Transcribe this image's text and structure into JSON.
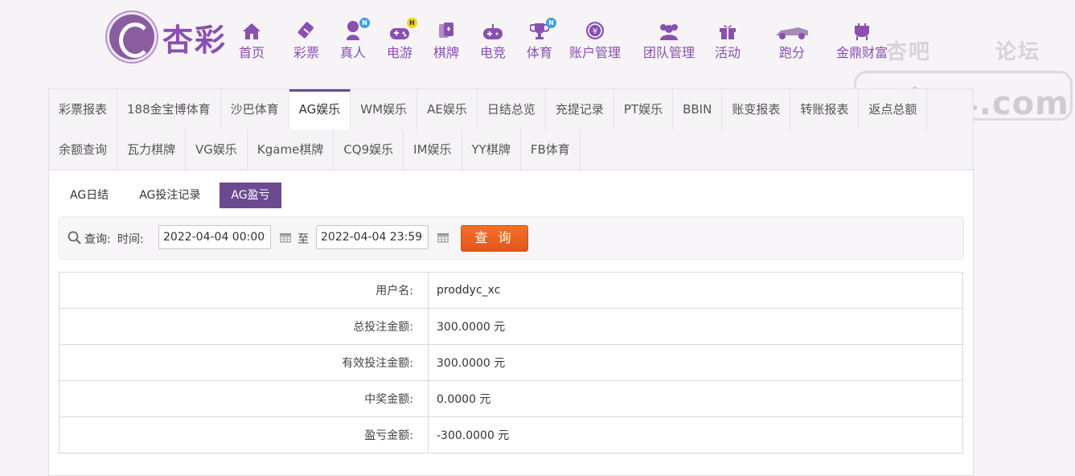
{
  "brand": {
    "name": "杏彩"
  },
  "nav": [
    {
      "label": "首页",
      "icon": "home-icon"
    },
    {
      "label": "彩票",
      "icon": "ticket-icon"
    },
    {
      "label": "真人",
      "icon": "live-dealer-icon",
      "badge": "N"
    },
    {
      "label": "电游",
      "icon": "gamepad-icon",
      "badge": "H"
    },
    {
      "label": "棋牌",
      "icon": "cards-icon"
    },
    {
      "label": "电竞",
      "icon": "esports-controller-icon"
    },
    {
      "label": "体育",
      "icon": "trophy-icon",
      "badge": "N"
    },
    {
      "label": "账户管理",
      "icon": "yen-coin-icon"
    },
    {
      "label": "团队管理",
      "icon": "team-icon"
    },
    {
      "label": "活动",
      "icon": "gift-icon"
    },
    {
      "label": "跑分",
      "icon": "race-car-icon"
    },
    {
      "label": "金鼎财富",
      "icon": "cauldron-icon"
    }
  ],
  "watermark": {
    "top_left": "杏吧",
    "top_right": "论坛",
    "url": "同家74.com"
  },
  "tabs_row1": [
    "彩票报表",
    "188金宝博体育",
    "沙巴体育",
    "AG娱乐",
    "WM娱乐",
    "AE娱乐",
    "日结总览",
    "充提记录",
    "PT娱乐",
    "BBIN",
    "账变报表",
    "转账报表",
    "返点总额"
  ],
  "tabs_row2": [
    "余额查询",
    "瓦力棋牌",
    "VG娱乐",
    "Kgame棋牌",
    "CQ9娱乐",
    "IM娱乐",
    "YY棋牌",
    "FB体育"
  ],
  "active_tab": "AG娱乐",
  "subtabs": [
    "AG日结",
    "AG投注记录",
    "AG盈亏"
  ],
  "active_subtab": "AG盈亏",
  "query": {
    "label": "查询:",
    "time_label": "时间:",
    "start": "2022-04-04 00:00:00",
    "to": "至",
    "end": "2022-04-04 23:59:59",
    "button": "查 询"
  },
  "result": [
    {
      "label": "用户名:",
      "value": "proddyc_xc"
    },
    {
      "label": "总投注金额:",
      "value": "300.0000 元"
    },
    {
      "label": "有效投注金额:",
      "value": "300.0000 元"
    },
    {
      "label": "中奖金额:",
      "value": "0.0000 元"
    },
    {
      "label": "盈亏金额:",
      "value": "-300.0000 元"
    }
  ],
  "colors": {
    "accent": "#6b4a91",
    "brand": "#8a4fb0",
    "button": "#ee6a24"
  }
}
